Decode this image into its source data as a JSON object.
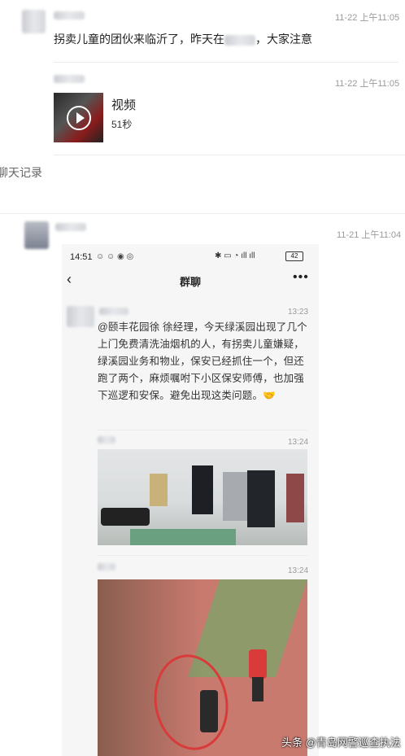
{
  "messages": [
    {
      "time": "11-22 上午11:05",
      "text": "拐卖儿童的团伙来临沂了，昨天在",
      "text_tail": "，大家注意"
    },
    {
      "time": "11-22 上午11:05",
      "video_label": "视频",
      "video_duration": "51秒"
    }
  ],
  "section_label": "聊天记录",
  "embedded": {
    "time": "11-21 上午11:04",
    "phone_time": "14:51",
    "battery": "42",
    "title": "群聊",
    "more_icon": "more-dots-icon",
    "quotes": [
      {
        "time": "13:23",
        "text": "@颐丰花园徐 徐经理，今天绿溪园出现了几个上门免费清洗油烟机的人，有拐卖儿童嫌疑，绿溪园业务和物业，保安已经抓住一个，但还跑了两个，麻烦嘱咐下小区保安师傅，也加强下巡逻和安保。避免出现这类问题。🤝"
      },
      {
        "time": "13:24"
      },
      {
        "time": "13:24"
      }
    ]
  },
  "watermark": "头条 @青岛网警巡查执法",
  "colors": {
    "accent_red": "#d93a3a",
    "play_white": "#ffffff",
    "grass": "#7c8a5a"
  }
}
